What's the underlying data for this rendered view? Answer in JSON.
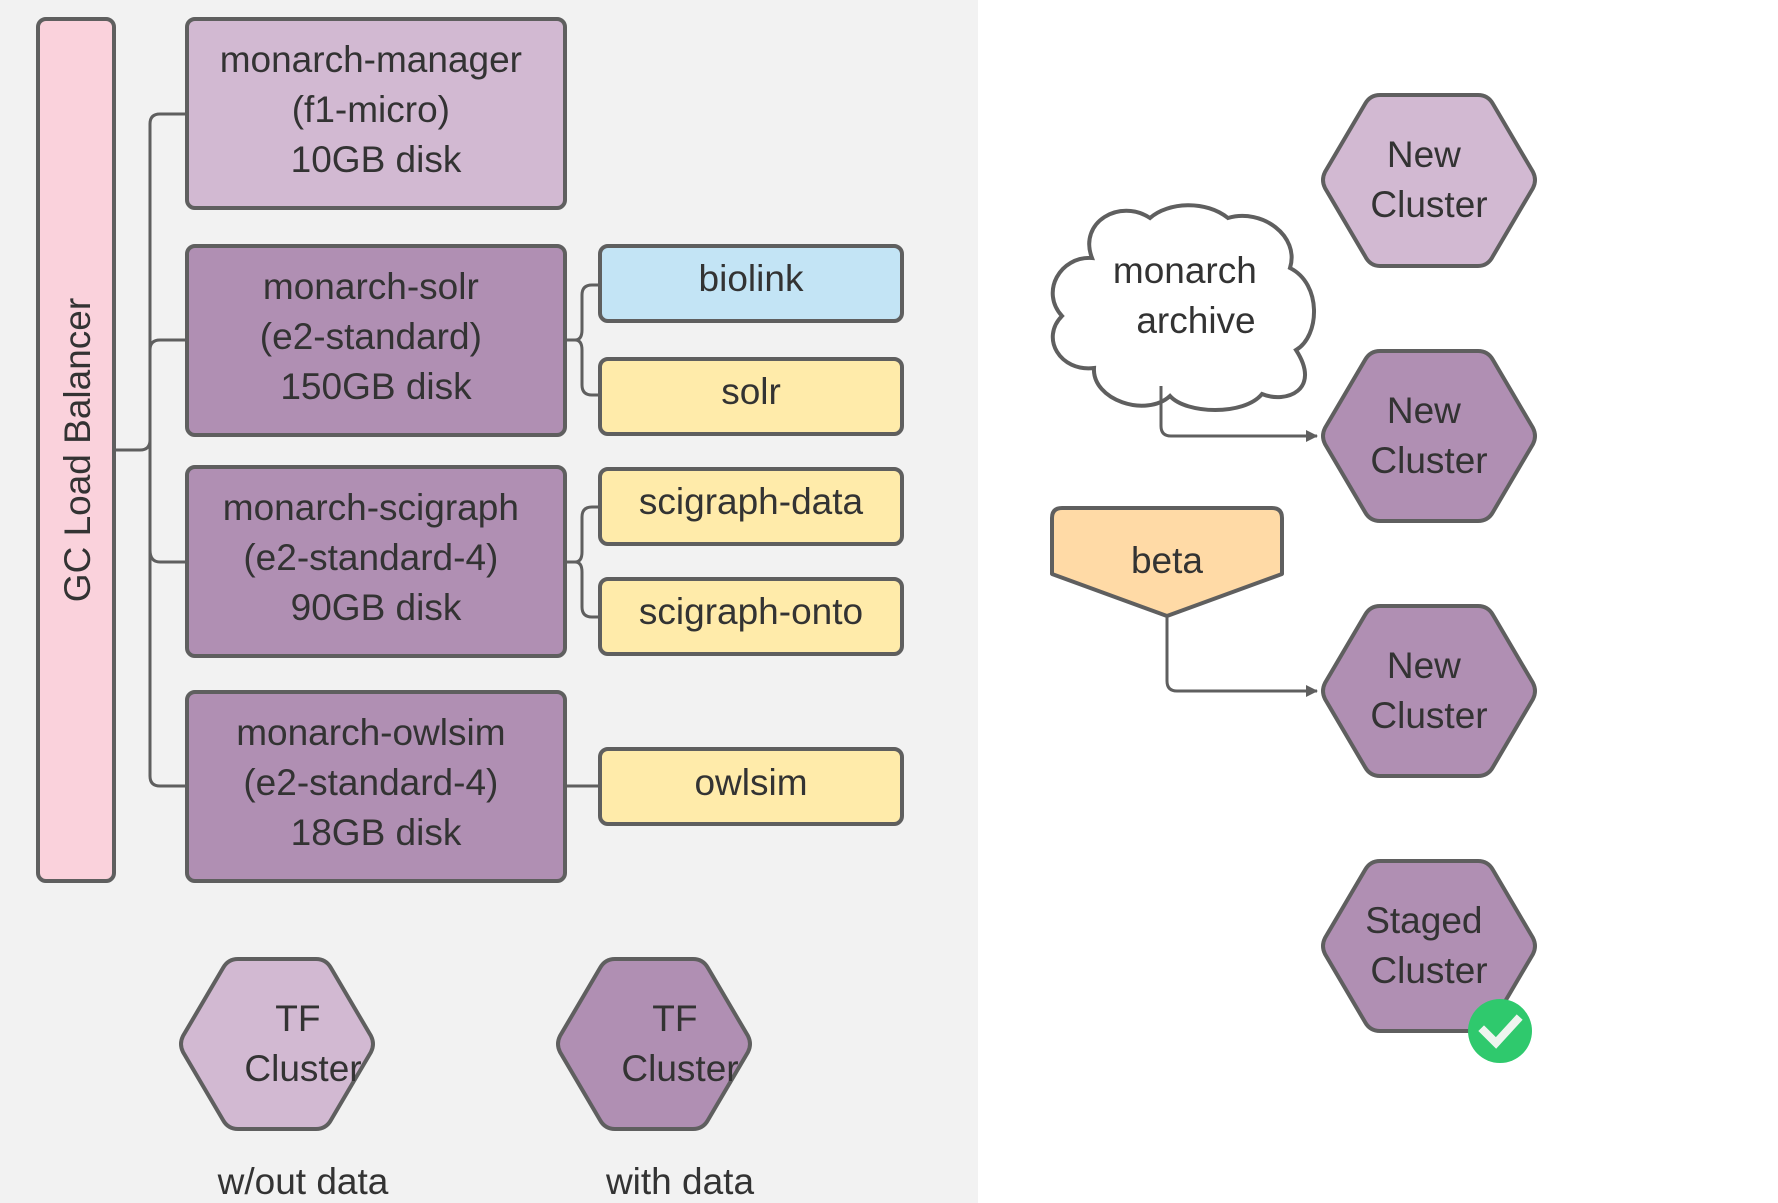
{
  "colors": {
    "left_panel_bg": "#f2f2f2",
    "right_panel_bg": "#ffffff",
    "stroke": "#5f5f5f",
    "balancer_fill": "#fad2dc",
    "light_purple": "#d2b9d2",
    "dark_purple": "#b08fb3",
    "blue": "#c3e4f5",
    "yellow": "#ffebaa",
    "orange": "#ffdaa6",
    "white": "#ffffff",
    "check_green": "#2fc96d",
    "text": "#333333"
  },
  "load_balancer": {
    "label": "GC Load Balancer"
  },
  "servers": [
    {
      "id": "manager",
      "lines": [
        "monarch-manager",
        "(f1-micro)",
        "10GB disk"
      ],
      "style": "light"
    },
    {
      "id": "solr",
      "lines": [
        "monarch-solr",
        "(e2-standard)",
        "150GB disk"
      ],
      "style": "dark"
    },
    {
      "id": "scigraph",
      "lines": [
        "monarch-scigraph",
        "(e2-standard-4)",
        "90GB disk"
      ],
      "style": "dark"
    },
    {
      "id": "owlsim",
      "lines": [
        "monarch-owlsim",
        "(e2-standard-4)",
        "18GB disk"
      ],
      "style": "dark"
    }
  ],
  "services": [
    {
      "id": "biolink",
      "label": "biolink",
      "style": "blue",
      "server": "solr"
    },
    {
      "id": "solr",
      "label": "solr",
      "style": "yellow",
      "server": "solr"
    },
    {
      "id": "scigraph-data",
      "label": "scigraph-data",
      "style": "yellow",
      "server": "scigraph"
    },
    {
      "id": "scigraph-onto",
      "label": "scigraph-onto",
      "style": "yellow",
      "server": "scigraph"
    },
    {
      "id": "owlsim",
      "label": "owlsim",
      "style": "yellow",
      "server": "owlsim"
    }
  ],
  "legend": [
    {
      "lines": [
        "TF",
        "Cluster"
      ],
      "caption": "w/out data",
      "style": "light"
    },
    {
      "lines": [
        "TF",
        "Cluster"
      ],
      "caption": "with data",
      "style": "dark"
    }
  ],
  "right": {
    "archive": {
      "lines": [
        "monarch",
        "archive"
      ]
    },
    "beta": {
      "label": "beta"
    },
    "clusters": [
      {
        "lines": [
          "New",
          "Cluster"
        ],
        "style": "light",
        "badge": null
      },
      {
        "lines": [
          "New",
          "Cluster"
        ],
        "style": "dark",
        "badge": null,
        "incoming": "archive"
      },
      {
        "lines": [
          "New",
          "Cluster"
        ],
        "style": "dark",
        "badge": null,
        "incoming": "beta"
      },
      {
        "lines": [
          "Staged",
          "Cluster"
        ],
        "style": "dark",
        "badge": "check-icon"
      }
    ]
  }
}
